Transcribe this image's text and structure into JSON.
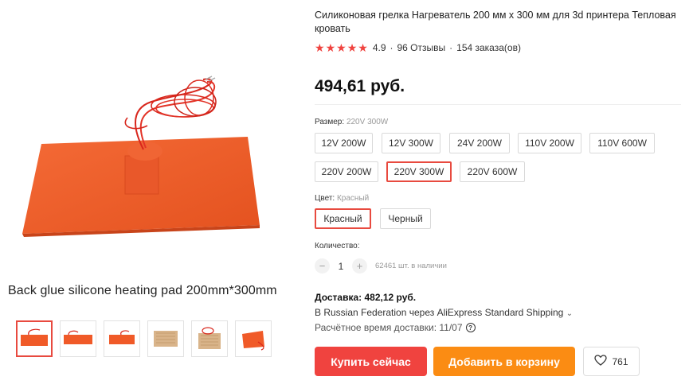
{
  "gallery": {
    "caption": "Back glue silicone heating pad 200mm*300mm",
    "thumbnails": [
      "thumb-1",
      "thumb-2",
      "thumb-3",
      "thumb-4",
      "thumb-5",
      "thumb-6"
    ],
    "active_thumbnail": 0
  },
  "product": {
    "title": "Силиконовая грелка Нагреватель 200 мм x 300 мм для 3d принтера Тепловая кровать",
    "rating": "4.9",
    "stars": 5,
    "reviews": "96 Отзывы",
    "orders": "154 заказа(ов)",
    "price": "494,61 руб."
  },
  "size_option": {
    "label": "Размер:",
    "selected_value": "220V 300W",
    "choices": [
      "12V 200W",
      "12V 300W",
      "24V 200W",
      "110V 200W",
      "110V 600W",
      "220V 200W",
      "220V 300W",
      "220V 600W"
    ],
    "selected_index": 6
  },
  "color_option": {
    "label": "Цвет:",
    "selected_value": "Красный",
    "choices": [
      "Красный",
      "Черный"
    ],
    "selected_index": 0
  },
  "quantity": {
    "label": "Количество:",
    "value": "1",
    "minus_icon": "minus-icon",
    "plus_icon": "plus-icon",
    "stock": "62461 шт. в наличии"
  },
  "shipping": {
    "title": "Доставка: 482,12 руб.",
    "method": "В Russian Federation через AliExpress Standard Shipping",
    "estimate": "Расчётное время доставки: 11/07"
  },
  "actions": {
    "buy_now": "Купить сейчас",
    "add_to_cart": "Добавить в корзину",
    "wishlist_count": "761"
  },
  "colors": {
    "accent_red": "#f0433f",
    "accent_orange": "#fb8c13",
    "pad_orange": "#f05a28"
  }
}
